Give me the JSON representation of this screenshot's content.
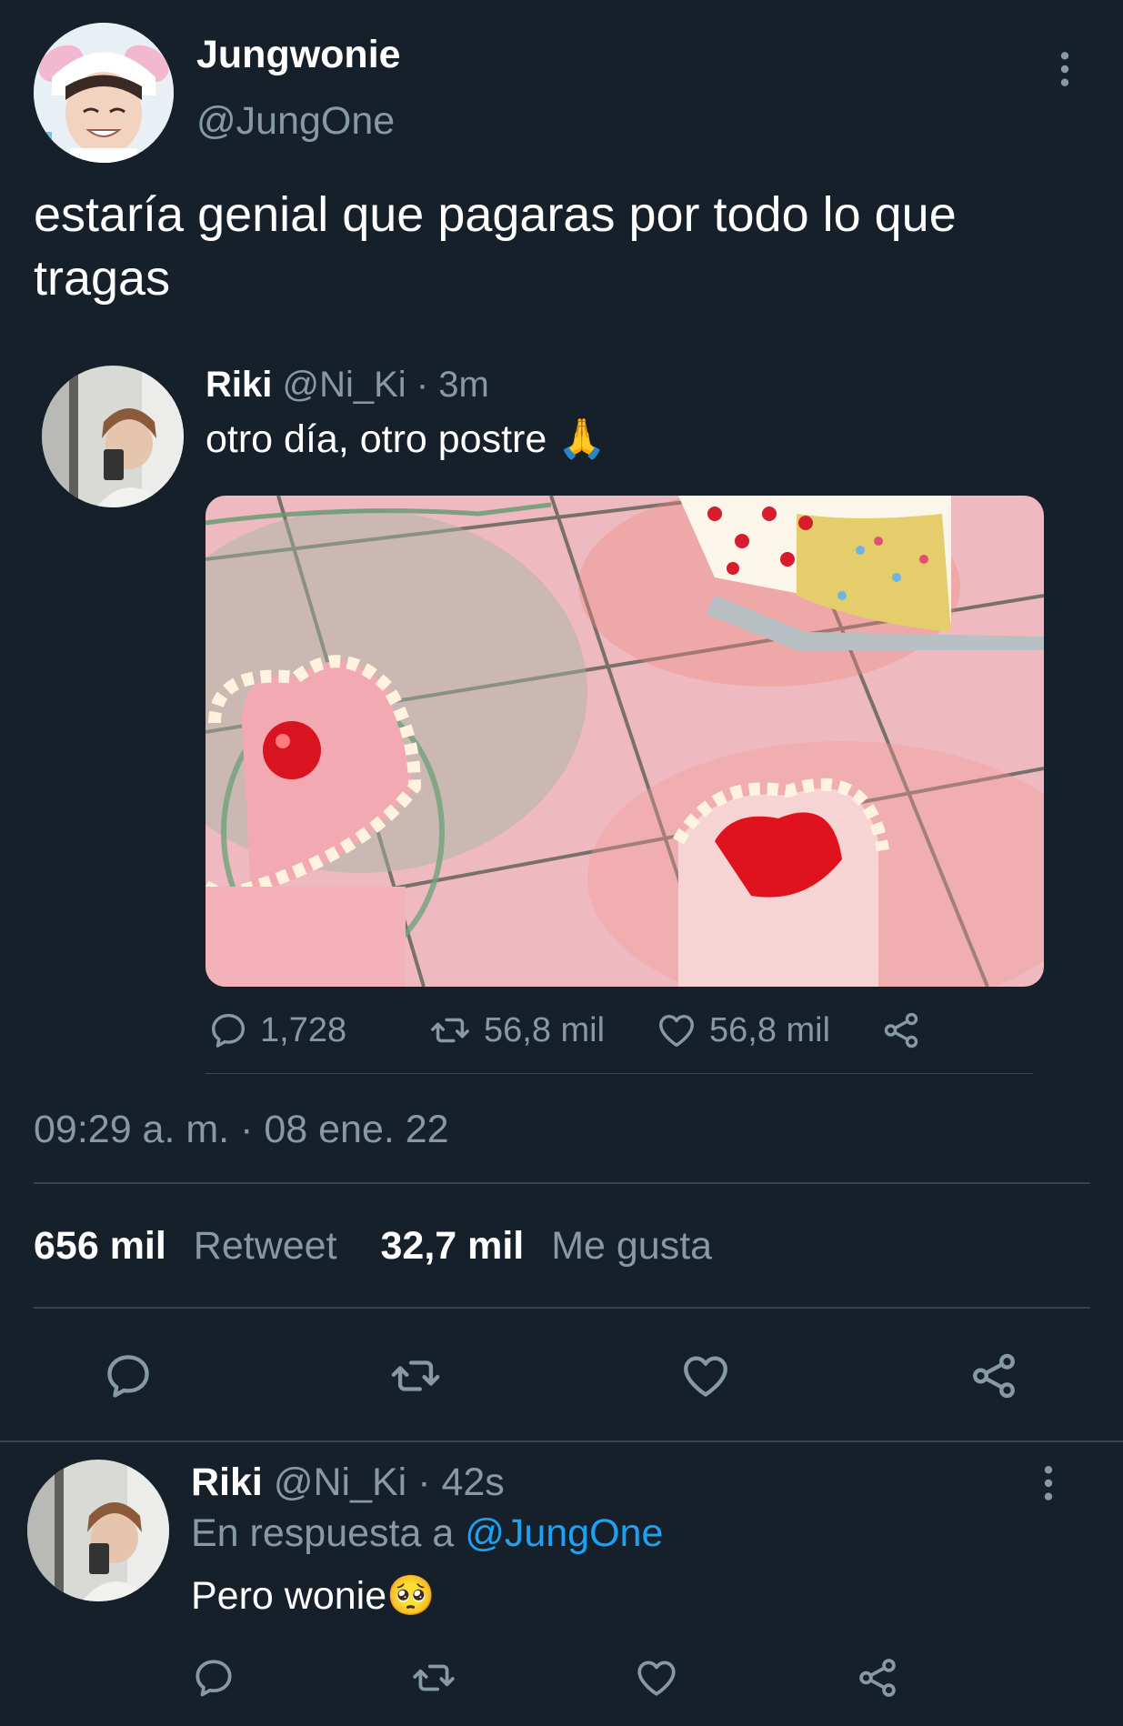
{
  "tweet": {
    "author_name": "Jungwonie",
    "author_handle": "@JungOne",
    "text": "estaría genial que pagaras por todo lo que tragas",
    "timestamp": "09:29 a. m. · 08 ene. 22",
    "retweet_count": "656 mil",
    "retweet_label": "Retweet",
    "like_count": "32,7 mil",
    "like_label": "Me gusta"
  },
  "quoted": {
    "author_name": "Riki",
    "author_handle": "@Ni_Ki",
    "time": "· 3m",
    "text": "otro día, otro postre 🙏",
    "replies": "1,728",
    "retweets": "56,8 mil",
    "likes": "56,8 mil"
  },
  "reply": {
    "author_name": "Riki",
    "author_handle": "@Ni_Ki",
    "time": "· 42s",
    "in_reply_prefix": "En respuesta a",
    "in_reply_handle": "@JungOne",
    "text": "Pero wonie🥺"
  },
  "icons": {
    "more": "more-vertical-icon",
    "reply": "reply-icon",
    "retweet": "retweet-icon",
    "like": "heart-icon",
    "share": "share-icon"
  },
  "colors": {
    "background": "#15202b",
    "muted": "#8899a6",
    "link": "#1da1f2",
    "divider": "#38444d"
  }
}
